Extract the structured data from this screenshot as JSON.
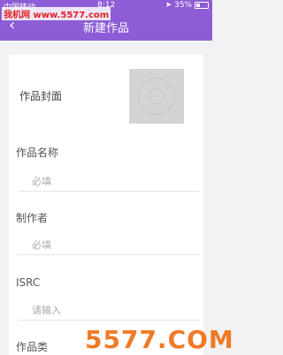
{
  "status": {
    "carrier": "中国移动",
    "time": "8:12",
    "battery": "35%"
  },
  "header": {
    "title": "新建作品"
  },
  "watermark": {
    "site": "我机网 www.5577.com",
    "brand": "5577.COM"
  },
  "form": {
    "cover_label": "作品封面",
    "name_label": "作品名称",
    "name_placeholder": "必填",
    "producer_label": "制作者",
    "producer_placeholder": "必填",
    "isrc_label": "ISRC",
    "isrc_placeholder": "请输入",
    "partial_label": "作品类"
  }
}
